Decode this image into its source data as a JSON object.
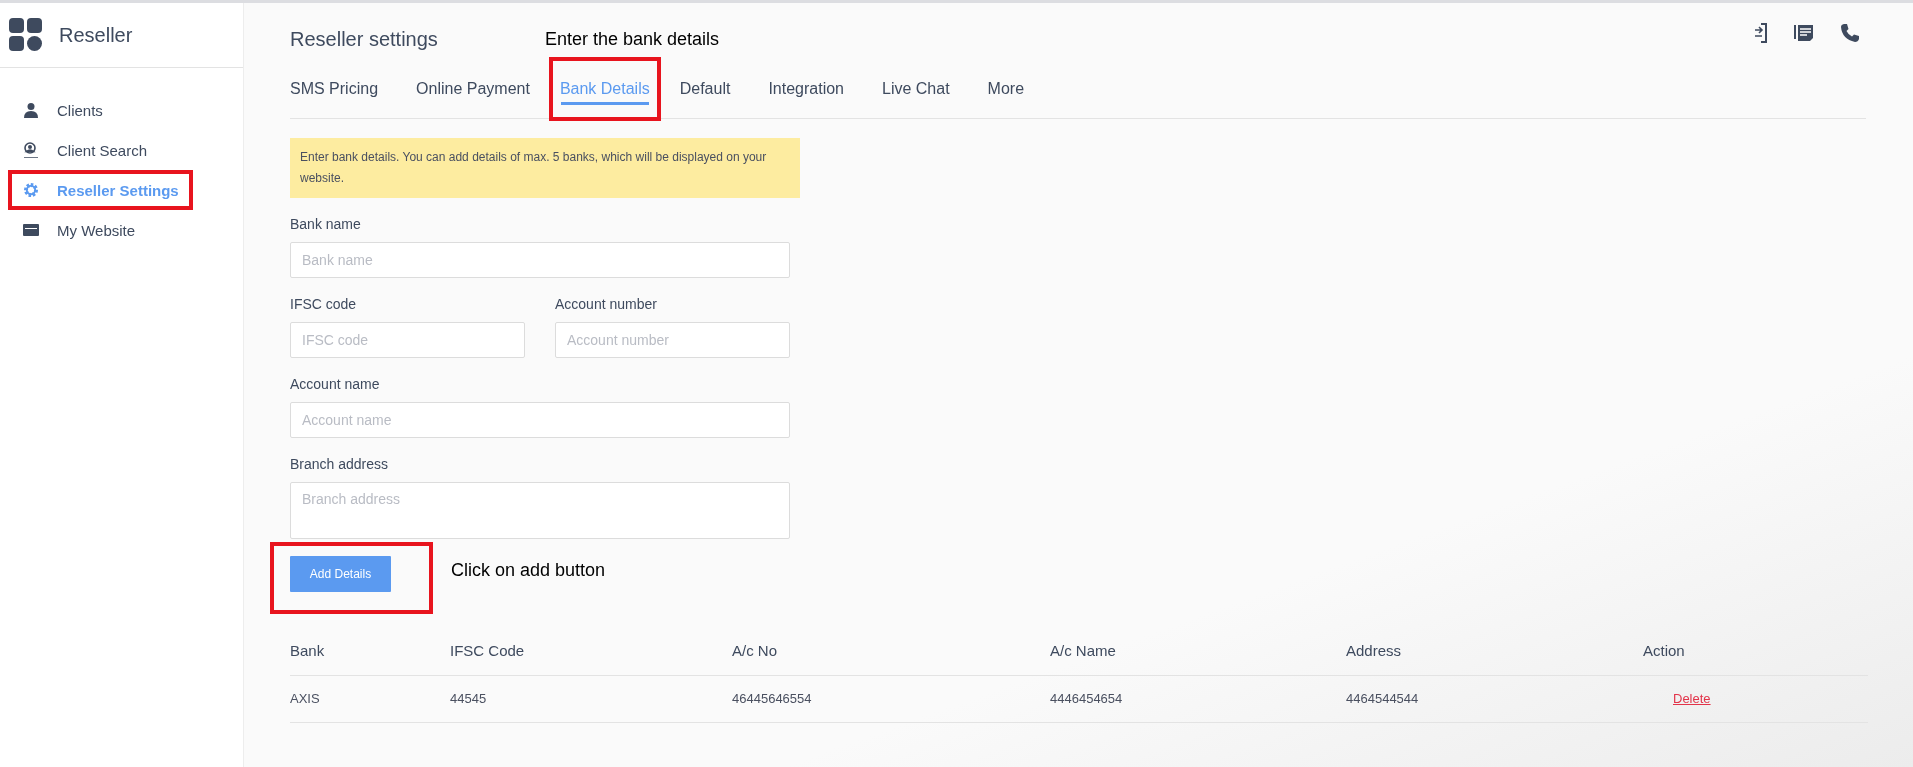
{
  "brand": {
    "name": "Reseller"
  },
  "sidebar": {
    "items": [
      {
        "label": "Clients",
        "kind": "user",
        "selected": false,
        "annotated": false
      },
      {
        "label": "Client Search",
        "kind": "search-user",
        "selected": false,
        "annotated": false
      },
      {
        "label": "Reseller Settings",
        "kind": "gear",
        "selected": true,
        "annotated": true
      },
      {
        "label": "My Website",
        "kind": "window",
        "selected": false,
        "annotated": false
      }
    ]
  },
  "header": {
    "title": "Reseller settings",
    "annotation": "Enter the bank details"
  },
  "tabs": [
    {
      "label": "SMS Pricing",
      "selected": false,
      "annotated": false
    },
    {
      "label": "Online Payment",
      "selected": false,
      "annotated": false
    },
    {
      "label": "Bank Details",
      "selected": true,
      "annotated": true
    },
    {
      "label": "Default",
      "selected": false,
      "annotated": false
    },
    {
      "label": "Integration",
      "selected": false,
      "annotated": false
    },
    {
      "label": "Live Chat",
      "selected": false,
      "annotated": false
    },
    {
      "label": "More",
      "selected": false,
      "annotated": false
    }
  ],
  "notice": "Enter bank details. You can add details of max. 5 banks, which will be displayed on your website.",
  "form": {
    "rows": [
      [
        {
          "label": "Bank name",
          "placeholder": "Bank name",
          "kind": "input"
        }
      ],
      [
        {
          "label": "IFSC code",
          "placeholder": "IFSC code",
          "kind": "input"
        },
        {
          "label": "Account number",
          "placeholder": "Account number",
          "kind": "input"
        }
      ],
      [
        {
          "label": "Account name",
          "placeholder": "Account name",
          "kind": "input"
        }
      ],
      [
        {
          "label": "Branch address",
          "placeholder": "Branch address",
          "kind": "textarea"
        }
      ]
    ],
    "button": {
      "label": "Add Details",
      "annotated": true
    },
    "annotation": "Click on add button"
  },
  "table": {
    "columns": [
      "Bank",
      "IFSC Code",
      "A/c No",
      "A/c Name",
      "Address",
      "Action"
    ],
    "rows": [
      {
        "cells": [
          "AXIS",
          "44545",
          "46445646554",
          "4446454654",
          "4464544544"
        ],
        "action": "Delete"
      }
    ]
  }
}
